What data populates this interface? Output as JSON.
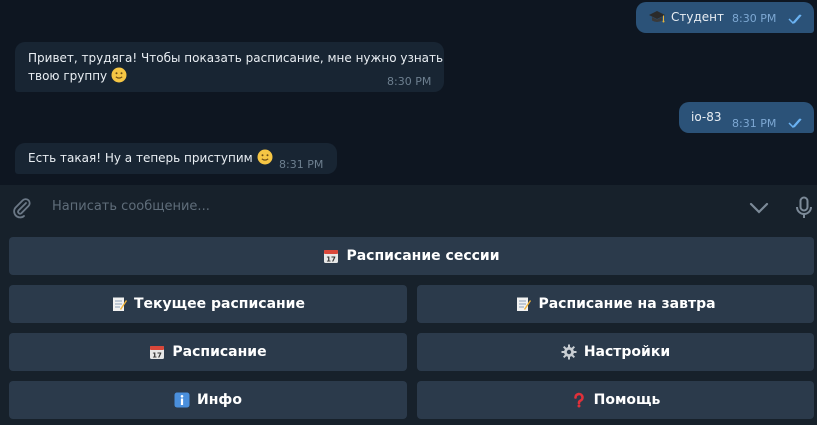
{
  "chat": {
    "messages": [
      {
        "direction": "out",
        "icon": "graduation-cap-emoji",
        "text": "Студент",
        "time": "8:30 PM",
        "status": "read"
      },
      {
        "direction": "in",
        "line1": "Привет, трудяга! Чтобы показать расписание, мне нужно узнать",
        "line2": "твою группу",
        "emoji": "slightly-smiling-face",
        "time": "8:30 PM"
      },
      {
        "direction": "out",
        "text": "io-83",
        "time": "8:31 PM",
        "status": "read"
      },
      {
        "direction": "in",
        "text": "Есть такая! Ну а теперь приступим",
        "emoji": "slightly-smiling-face",
        "time": "8:31 PM"
      }
    ]
  },
  "composer": {
    "placeholder": "Написать сообщение...",
    "attach_icon": "paperclip-icon",
    "collapse_icon": "chevron-down-icon",
    "mic_icon": "microphone-icon"
  },
  "keyboard": {
    "buttons": [
      {
        "label": "Расписание сессии",
        "icon": "calendar-icon"
      },
      {
        "label": "Текущее расписание",
        "icon": "memo-icon"
      },
      {
        "label": "Расписание на завтра",
        "icon": "memo-icon"
      },
      {
        "label": "Расписание",
        "icon": "calendar-icon"
      },
      {
        "label": "Настройки",
        "icon": "gear-icon"
      },
      {
        "label": "Инфо",
        "icon": "info-icon"
      },
      {
        "label": "Помощь",
        "icon": "question-mark-icon"
      }
    ]
  },
  "colors": {
    "chat_background": "#0e1621",
    "incoming_bubble": "#182533",
    "outgoing_bubble": "#2b5278",
    "panel_background": "#17212b",
    "keyboard_button": "#2b3a4b",
    "read_ticks": "#6ab2f2"
  }
}
